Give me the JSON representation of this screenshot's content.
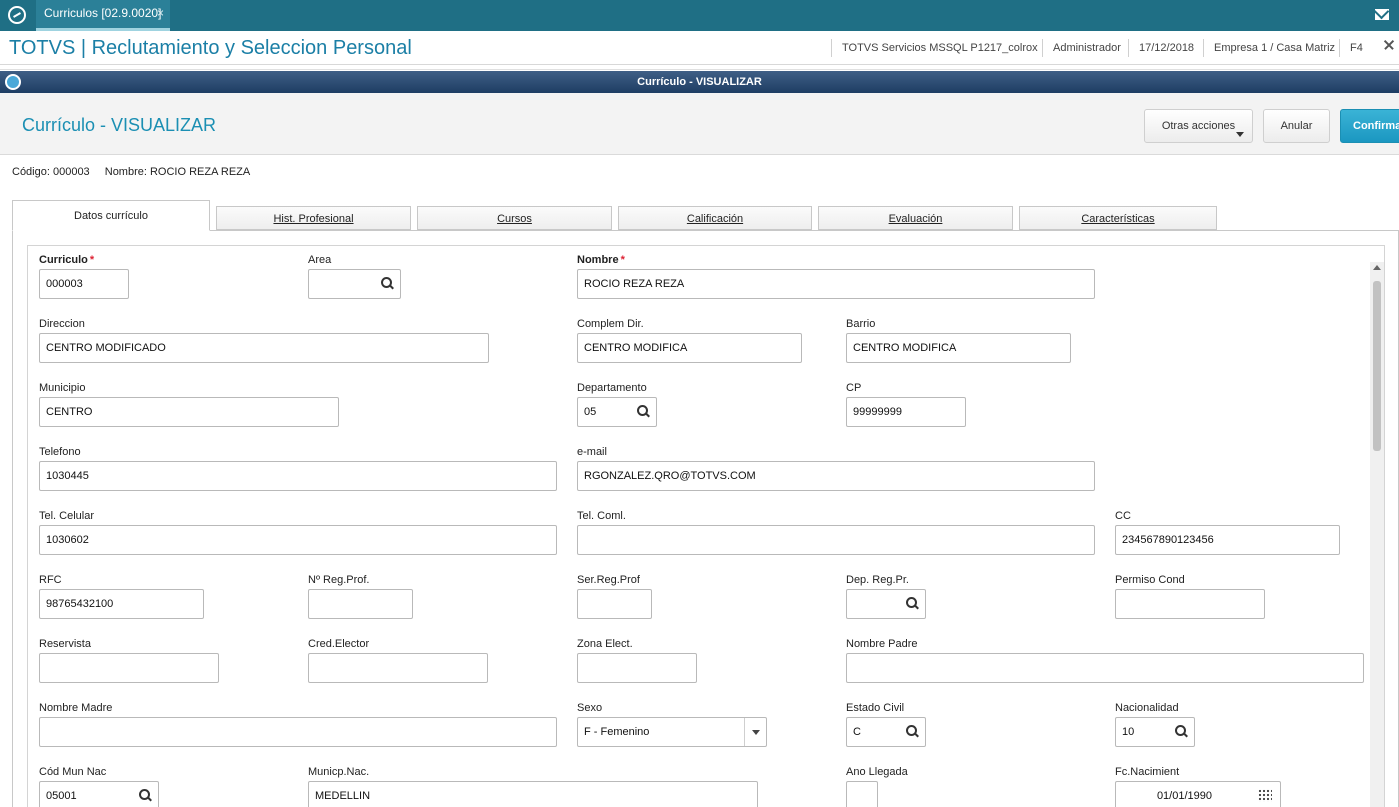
{
  "topbar": {
    "tab_label": "Curriculos [02.9.0020]",
    "close_glyph": "×"
  },
  "titlebar": {
    "app_title": "TOTVS | Reclutamiento y Seleccion Personal",
    "server": "TOTVS Servicios MSSQL P1217_colrox",
    "user": "Administrador",
    "date": "17/12/2018",
    "company": "Empresa 1 / Casa Matriz",
    "key": "F4"
  },
  "window": {
    "title": "Currículo - VISUALIZAR"
  },
  "dialog": {
    "title": "Currículo - VISUALIZAR",
    "other_actions": "Otras acciones",
    "cancel": "Anular",
    "confirm": "Confirmar"
  },
  "record": {
    "code": "Código: 000003",
    "name": "Nombre: ROCIO REZA REZA"
  },
  "tabs": [
    "Datos currículo",
    "Hist. Profesional",
    "Cursos",
    "Calificación",
    "Evaluación",
    "Características"
  ],
  "fields": {
    "curriculo": {
      "label": "Curriculo",
      "value": "000003"
    },
    "area": {
      "label": "Area",
      "value": ""
    },
    "nombre": {
      "label": "Nombre",
      "value": "ROCIO REZA REZA"
    },
    "direccion": {
      "label": "Direccion",
      "value": "CENTRO MODIFICADO"
    },
    "complem_dir": {
      "label": "Complem Dir.",
      "value": "CENTRO MODIFICA"
    },
    "barrio": {
      "label": "Barrio",
      "value": "CENTRO MODIFICA"
    },
    "municipio": {
      "label": "Municipio",
      "value": "CENTRO"
    },
    "departamento": {
      "label": "Departamento",
      "value": "05"
    },
    "cp": {
      "label": "CP",
      "value": "99999999"
    },
    "telefono": {
      "label": "Telefono",
      "value": "1030445"
    },
    "email": {
      "label": "e-mail",
      "value": "RGONZALEZ.QRO@TOTVS.COM"
    },
    "tel_celular": {
      "label": "Tel. Celular",
      "value": "1030602"
    },
    "tel_coml": {
      "label": "Tel. Coml.",
      "value": ""
    },
    "cc": {
      "label": "CC",
      "value": "234567890123456"
    },
    "rfc": {
      "label": "RFC",
      "value": "98765432100"
    },
    "reg_prof": {
      "label": "Nº Reg.Prof.",
      "value": ""
    },
    "ser_reg_prof": {
      "label": "Ser.Reg.Prof",
      "value": ""
    },
    "dep_reg_pr": {
      "label": "Dep. Reg.Pr.",
      "value": ""
    },
    "permiso_cond": {
      "label": "Permiso Cond",
      "value": ""
    },
    "reservista": {
      "label": "Reservista",
      "value": ""
    },
    "cred_elector": {
      "label": "Cred.Elector",
      "value": ""
    },
    "zona_elect": {
      "label": "Zona Elect.",
      "value": ""
    },
    "nombre_padre": {
      "label": "Nombre Padre",
      "value": ""
    },
    "nombre_madre": {
      "label": "Nombre Madre",
      "value": ""
    },
    "sexo": {
      "label": "Sexo",
      "value": "F - Femenino"
    },
    "estado_civil": {
      "label": "Estado Civil",
      "value": "C"
    },
    "nacionalidad": {
      "label": "Nacionalidad",
      "value": "10"
    },
    "cod_mun_nac": {
      "label": "Cód Mun Nac",
      "value": "05001"
    },
    "municp_nac": {
      "label": "Municp.Nac.",
      "value": "MEDELLIN"
    },
    "ano_llegada": {
      "label": "Ano Llegada",
      "value": ""
    },
    "fc_naciment": {
      "label": "Fc.Nacimient",
      "value": "01/01/1990"
    }
  },
  "icons": {
    "search": "search-icon",
    "calendar": "calendar-icon",
    "dropdown": "chevron-down-icon"
  },
  "colors": {
    "topbar": "#1f6f85",
    "title_text": "#1b7fa6",
    "confirm_button": "#1b97c1",
    "window_header": "#2d4d74"
  }
}
